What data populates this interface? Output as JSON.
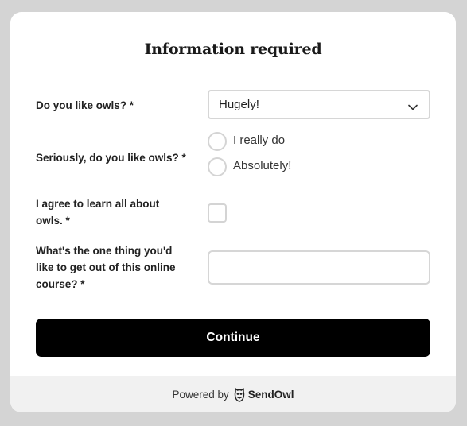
{
  "form": {
    "title": "Information required",
    "q1": {
      "label": "Do you like owls? *",
      "selected": "Hugely!"
    },
    "q2": {
      "label": "Seriously, do you like owls? *",
      "options": [
        "I really do",
        "Absolutely!"
      ]
    },
    "q3": {
      "label": "I agree to learn all about owls. *",
      "checked": false
    },
    "q4": {
      "label": "What's the one thing you'd like to get out of this online course? *",
      "value": ""
    },
    "continue_label": "Continue"
  },
  "footer": {
    "powered_by": "Powered by",
    "brand": "SendOwl"
  },
  "icons": {
    "dropdown": "chevron-down-icon",
    "logo": "owl-logo-icon"
  },
  "colors": {
    "background": "#d4d4d4",
    "card": "#ffffff",
    "button": "#000000",
    "footer": "#f1f1f1",
    "border": "#d6d6d6"
  }
}
